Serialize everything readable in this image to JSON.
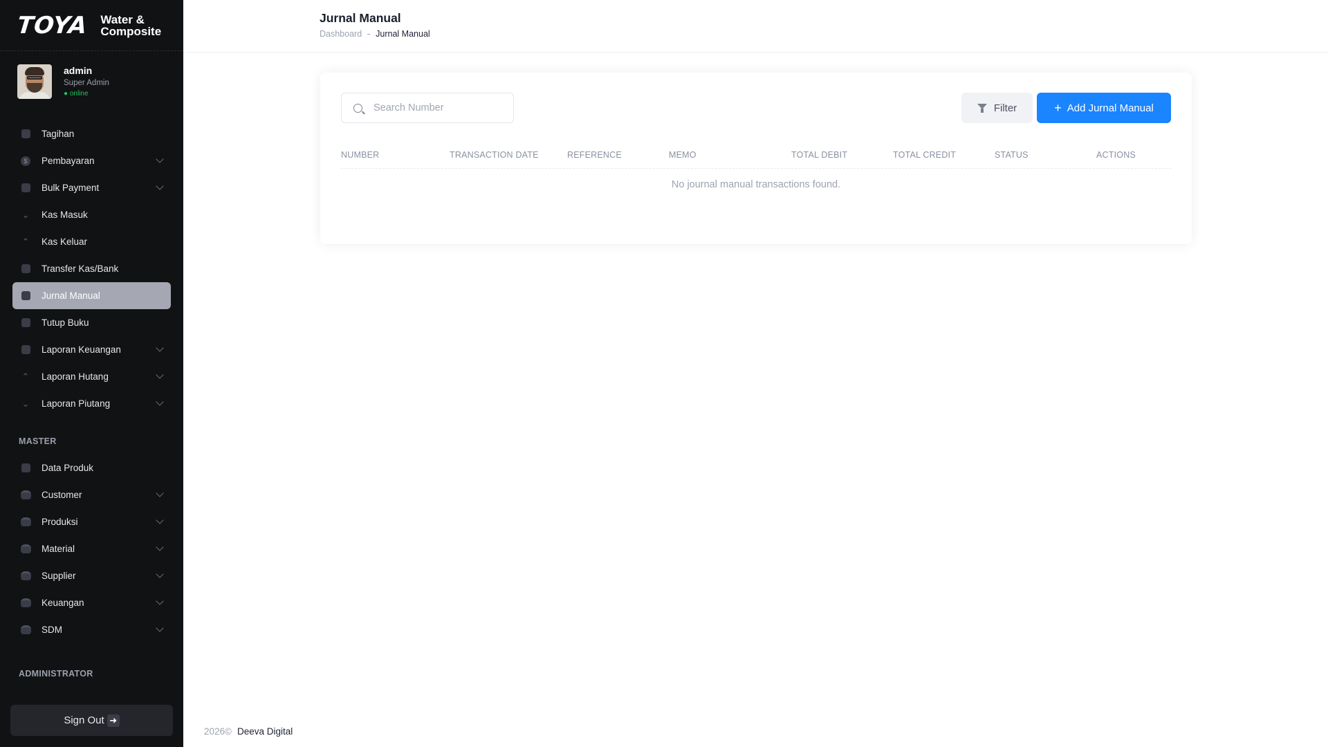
{
  "brand": {
    "logo": "TOYA",
    "name": "Water & Composite"
  },
  "user": {
    "name": "admin",
    "role": "Super Admin",
    "status": "● online"
  },
  "nav_main": [
    {
      "label": "Tagihan",
      "icon": "document-icon",
      "expandable": false
    },
    {
      "label": "Pembayaran",
      "icon": "dollar-icon",
      "expandable": true
    },
    {
      "label": "Bulk Payment",
      "icon": "wallet-icon",
      "expandable": true
    },
    {
      "label": "Kas Masuk",
      "icon": "arrow-down-icon",
      "expandable": false
    },
    {
      "label": "Kas Keluar",
      "icon": "arrow-up-icon",
      "expandable": false
    },
    {
      "label": "Transfer Kas/Bank",
      "icon": "transfer-icon",
      "expandable": false
    },
    {
      "label": "Jurnal Manual",
      "icon": "document-icon",
      "expandable": false,
      "active": true
    },
    {
      "label": "Tutup Buku",
      "icon": "calendar-icon",
      "expandable": false
    },
    {
      "label": "Laporan Keuangan",
      "icon": "chart-icon",
      "expandable": true
    },
    {
      "label": "Laporan Hutang",
      "icon": "arrow-up-icon",
      "expandable": true
    },
    {
      "label": "Laporan Piutang",
      "icon": "arrow-down-icon",
      "expandable": true
    }
  ],
  "section_master": "MASTER",
  "nav_master": [
    {
      "label": "Data Produk",
      "icon": "book-icon",
      "expandable": false
    },
    {
      "label": "Customer",
      "icon": "database-icon",
      "expandable": true
    },
    {
      "label": "Produksi",
      "icon": "database-icon",
      "expandable": true
    },
    {
      "label": "Material",
      "icon": "database-icon",
      "expandable": true
    },
    {
      "label": "Supplier",
      "icon": "database-icon",
      "expandable": true
    },
    {
      "label": "Keuangan",
      "icon": "database-icon",
      "expandable": true
    },
    {
      "label": "SDM",
      "icon": "database-icon",
      "expandable": true
    }
  ],
  "section_admin": "ADMINISTRATOR",
  "signout_label": "Sign Out",
  "header": {
    "title": "Jurnal Manual",
    "breadcrumb_home": "Dashboard",
    "breadcrumb_current": "Jurnal Manual"
  },
  "toolbar": {
    "search_placeholder": "Search Number",
    "filter_label": "Filter",
    "add_label": "Add Jurnal Manual"
  },
  "table": {
    "columns": [
      "NUMBER",
      "TRANSACTION DATE",
      "REFERENCE",
      "MEMO",
      "TOTAL DEBIT",
      "TOTAL CREDIT",
      "STATUS",
      "ACTIONS"
    ],
    "empty_message": "No journal manual transactions found."
  },
  "footer": {
    "year": "2026©",
    "company": "Deeva Digital"
  },
  "colors": {
    "sidebar_bg": "#111214",
    "primary": "#1b84ff",
    "active_item": "#a5a8b3",
    "online": "#22c55e"
  }
}
